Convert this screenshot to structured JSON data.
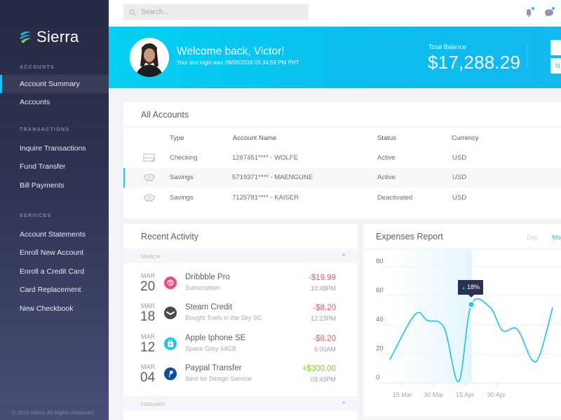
{
  "brand": {
    "name": "Sierra",
    "copyright": "© 2016 Sierra. All Rights Reserved."
  },
  "sidebar": {
    "sections": [
      {
        "heading": "ACCOUNTS",
        "items": [
          {
            "label": "Account Summary",
            "active": true
          },
          {
            "label": "Accounts",
            "active": false
          }
        ]
      },
      {
        "heading": "TRANSACTIONS",
        "items": [
          {
            "label": "Inquire Transactions"
          },
          {
            "label": "Fund Transfer"
          },
          {
            "label": "Bill Payments"
          }
        ]
      },
      {
        "heading": "SERVICES",
        "items": [
          {
            "label": "Account Statements"
          },
          {
            "label": "Enroll New Account"
          },
          {
            "label": "Enroll a Credit Card"
          },
          {
            "label": "Card Replacement"
          },
          {
            "label": "New Checkbook"
          }
        ]
      }
    ]
  },
  "topbar": {
    "search_placeholder": "Search...",
    "icons": [
      {
        "name": "bell-icon",
        "has_badge": true
      },
      {
        "name": "chat-icon",
        "has_badge": true
      }
    ]
  },
  "hero": {
    "welcome": "Welcome back, Victor!",
    "last_login": "Your last login was 09/06/2016 05:34:59 PM PHT",
    "balance_label": "Total Balance",
    "balance_value": "$17,288.29",
    "button_2_label": "N"
  },
  "accounts": {
    "title": "All Accounts",
    "columns": [
      "Type",
      "Account Name",
      "Status",
      "Currency"
    ],
    "rows": [
      {
        "icon": "check-icon",
        "type": "Checking",
        "name": "1267451**** - WOLFE",
        "status": "Active",
        "currency": "USD",
        "selected": false
      },
      {
        "icon": "piggy-bank-icon",
        "type": "Savings",
        "name": "5719371**** - MAENGUNE",
        "status": "Active",
        "currency": "USD",
        "selected": true
      },
      {
        "icon": "piggy-bank-icon",
        "type": "Savings",
        "name": "7125781**** - KAISER",
        "status": "Deactivated",
        "currency": "USD",
        "selected": false
      }
    ]
  },
  "activity": {
    "title": "Recent Activity",
    "groups": [
      {
        "month": "MARCH",
        "transactions": [
          {
            "mon": "MAR",
            "day": "20",
            "icon": "dribbble-icon",
            "icon_color": "#ea4c89",
            "name": "Dribbble Pro",
            "sub": "Subscription",
            "amount": "-$19.99",
            "sign": "neg",
            "time": "10:48PM"
          },
          {
            "mon": "MAR",
            "day": "18",
            "icon": "steam-icon",
            "icon_color": "#4b4a48",
            "name": "Steam Credit",
            "sub": "Bought Trails in the Sky SC",
            "amount": "-$8.20",
            "sign": "neg",
            "time": "12:23PM"
          },
          {
            "mon": "MAR",
            "day": "12",
            "icon": "apple-store-icon",
            "icon_color": "#1cc6f3",
            "name": "Apple Iphone SE",
            "sub": "Space Grey 64GB",
            "amount": "-$8.20",
            "sign": "neg",
            "time": "5:00AM"
          },
          {
            "mon": "MAR",
            "day": "04",
            "icon": "paypal-icon",
            "icon_color": "#0b4f9f",
            "name": "Paypal Transfer",
            "sub": "Sent for Design Service",
            "amount": "+$300.00",
            "sign": "pos",
            "time": "03:49PM"
          }
        ]
      },
      {
        "month": "FEBUARY",
        "transactions": []
      }
    ]
  },
  "expenses": {
    "title": "Expenses Report",
    "tabs": [
      {
        "label": "Day",
        "active": false
      },
      {
        "label": "Mo",
        "active": true
      }
    ],
    "accent": "#1ec0f2"
  },
  "chart_data": {
    "type": "line",
    "title": "Expenses Report",
    "xlabel": "",
    "ylabel": "",
    "ylim": [
      0,
      80
    ],
    "yticks": [
      0,
      20,
      40,
      60,
      80
    ],
    "xticks": [
      "15 Mar",
      "30 Mar",
      "15 Apr",
      "30 Apr"
    ],
    "grid": true,
    "series": [
      {
        "name": "Expenses",
        "x_days": [
          -6,
          6,
          12,
          20,
          27,
          33,
          42,
          48,
          55,
          62,
          66,
          72
        ],
        "values": [
          16,
          47,
          43,
          38,
          1,
          54,
          52,
          36,
          37,
          16,
          20,
          52
        ],
        "color": "#1ec0f2"
      }
    ],
    "highlight": {
      "x_days": 33,
      "value": 54,
      "label": "18%",
      "direction": "up"
    },
    "x_domain_days": [
      -11,
      76
    ],
    "x_tick_days": [
      0,
      15,
      30,
      45
    ],
    "note": "x_days are days since 15 Mar"
  }
}
